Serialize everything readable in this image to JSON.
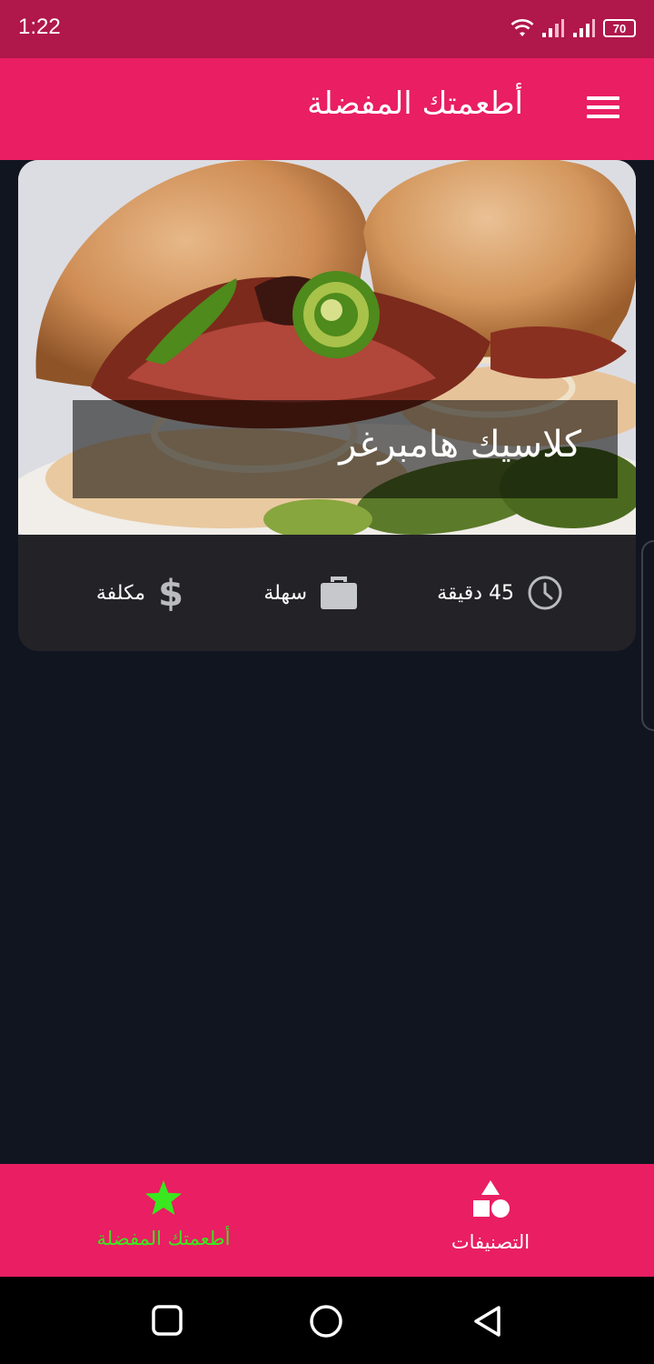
{
  "status_bar": {
    "time": "1:22",
    "battery": "70"
  },
  "app_bar": {
    "title": "أطعمتك المفضلة",
    "menu_icon": "menu-icon"
  },
  "meal": {
    "title": "كلاسيك هامبرغر",
    "duration": "45 دقيقة",
    "complexity": "سهلة",
    "affordability": "مكلفة"
  },
  "bottom_nav": {
    "items": [
      {
        "label": "التصنيفات",
        "icon": "categories-icon",
        "active": false
      },
      {
        "label": "أطعمتك المفضلة",
        "icon": "star-icon",
        "active": true
      }
    ]
  },
  "colors": {
    "primary": "#e91e63",
    "status_bar": "#b0174a",
    "background": "#101520",
    "card": "#232327",
    "active_nav": "#39e81e"
  }
}
